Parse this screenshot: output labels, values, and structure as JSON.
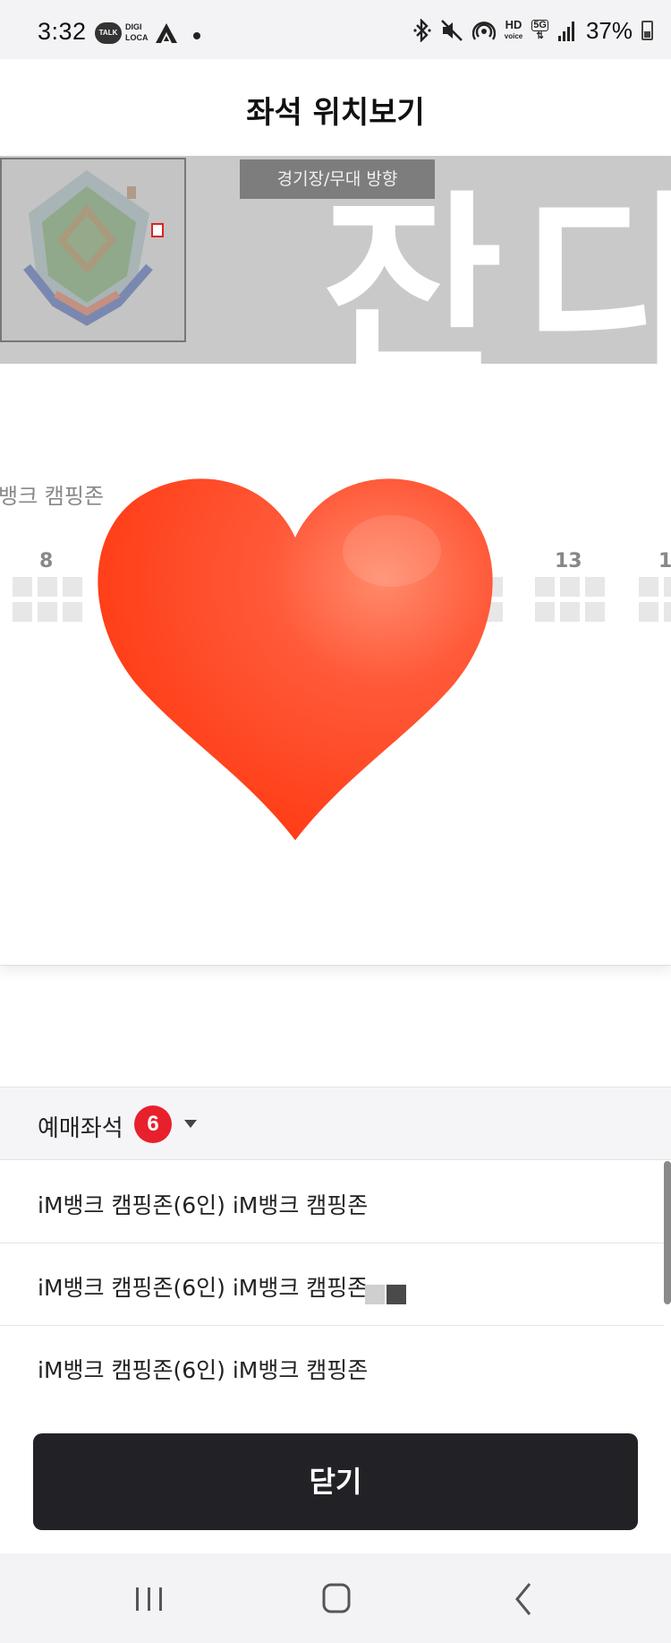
{
  "status_bar": {
    "time": "3:32",
    "talk_badge": "TALK",
    "digi_line1": "DIGI",
    "digi_line2": "LOCA",
    "hd_line1": "HD",
    "hd_line2": "voice",
    "network": "5G",
    "battery_percent": "37%",
    "battery_level": 0.37,
    "icons": [
      "talk-icon",
      "digi-loca-icon",
      "arrow-icon",
      "dot-icon",
      "bluetooth-icon",
      "mute-icon",
      "hotspot-icon",
      "hd-voice-icon",
      "5g-icon",
      "signal-icon",
      "battery-icon"
    ]
  },
  "header": {
    "title": "좌석 위치보기"
  },
  "seat_map": {
    "stage_direction_label": "경기장/무대 방향",
    "banner_text": "잔디",
    "zone_name": "뱅크 캠핑존",
    "row_numbers": [
      "8",
      "13",
      "1"
    ],
    "seat_color": "#e7e7e7",
    "heart_color": "#ff4a2e"
  },
  "reserved": {
    "title": "예매좌석",
    "count": "6",
    "items": [
      "iM뱅크 캠핑존(6인) iM뱅크 캠핑존",
      "iM뱅크 캠핑존(6인) iM뱅크 캠핑존",
      "iM뱅크 캠핑존(6인) iM뱅크 캠핑존"
    ],
    "accent_color": "#e8202c"
  },
  "close_button": {
    "label": "닫기"
  },
  "nav_bar": {
    "icons": [
      "recents-icon",
      "home-icon",
      "back-icon"
    ]
  }
}
